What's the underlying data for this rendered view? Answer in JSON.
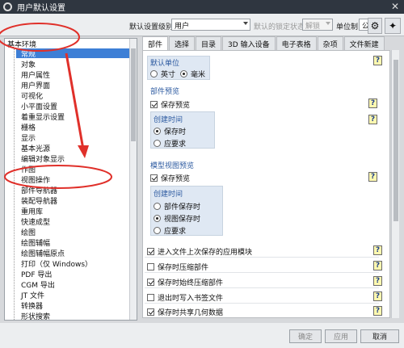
{
  "window": {
    "title": "用户默认设置"
  },
  "toolbar": {
    "level_label": "默认设置级别",
    "level_value": "用户",
    "lock_label": "默认的锁定状态",
    "lock_value": "解锁",
    "unit_label": "单位制",
    "unit_value": "公制"
  },
  "tree": {
    "root": "基本环境",
    "items": [
      "常规",
      "对象",
      "用户属性",
      "用户界面",
      "可视化",
      "小平面设置",
      "着重显示设置",
      "栅格",
      "显示",
      "基本光源",
      "编辑对象显示",
      "作图",
      "视图操作",
      "部件导航器",
      "装配导航器",
      "重用库",
      "快速成型",
      "绘图",
      "绘图辅幅",
      "绘图辅幅原点",
      "打印（仅 Windows）",
      "PDF 导出",
      "CGM 导出",
      "JT 文件",
      "转换器",
      "形状搜索"
    ]
  },
  "tabs": [
    "部件",
    "选择",
    "目录",
    "3D 输入设备",
    "电子表格",
    "杂项",
    "文件新建"
  ],
  "content": {
    "default_units": {
      "title": "默认单位",
      "opt1": "英寸",
      "opt2": "毫米"
    },
    "part_preview": {
      "title": "部件预览",
      "save_preview": "保存预览",
      "create_time": "创建时间",
      "opt1": "保存时",
      "opt2": "应要求"
    },
    "model_view_preview": {
      "title": "模型视图预览",
      "save_preview": "保存预览",
      "create_time": "创建时间",
      "opt1": "部件保存时",
      "opt2": "视图保存时",
      "opt3": "应要求"
    },
    "options": [
      "进入文件上次保存的应用模块",
      "保存时压缩部件",
      "保存时始终压缩部件",
      "退出时写入书签文件",
      "保存时共享几何数据"
    ]
  },
  "help_glyph": "?",
  "buttons": {
    "ok": "确定",
    "apply": "应用",
    "cancel": "取消"
  },
  "icons": {
    "title": "gear-icon",
    "close": "close-icon"
  },
  "colors": {
    "selection": "#3d7fd6",
    "annotation": "#e0302a",
    "title_bar": "#2f3640"
  }
}
